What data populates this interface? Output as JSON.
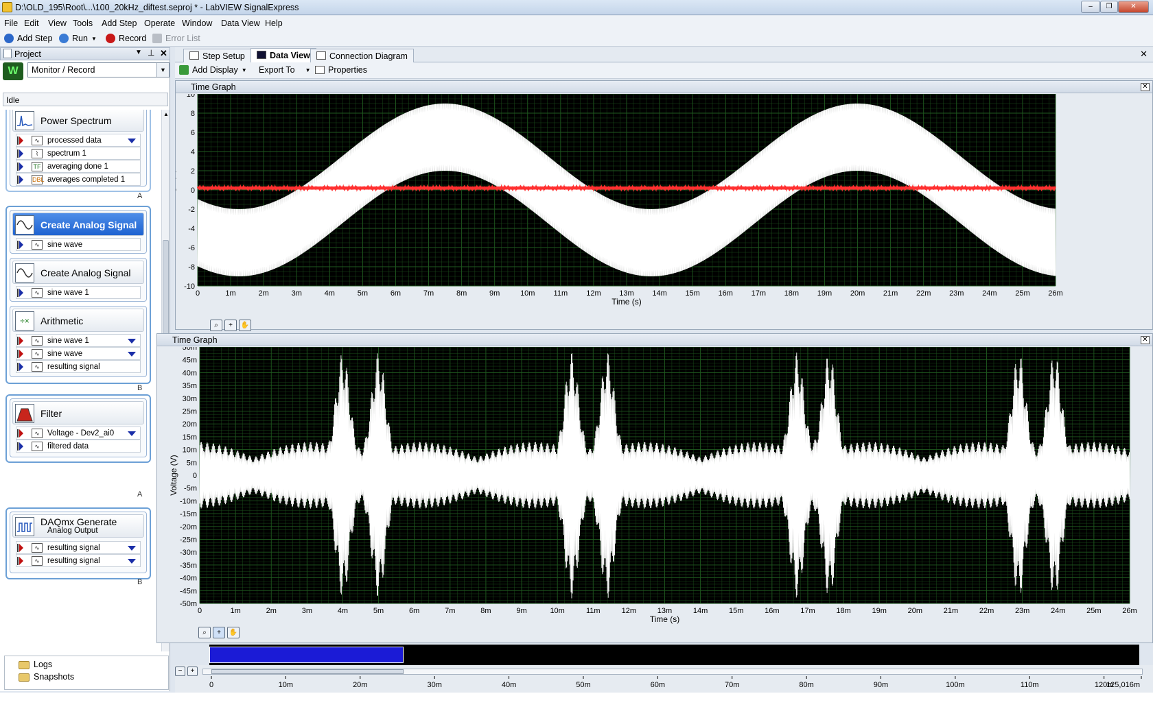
{
  "window": {
    "title": "D:\\OLD_195\\Root\\...\\100_20kHz_diftest.seproj * - LabVIEW SignalExpress",
    "controls": [
      "–",
      "❐",
      "✕"
    ]
  },
  "menu": [
    "File",
    "Edit",
    "View",
    "Tools",
    "Add Step",
    "Operate",
    "Window",
    "Data View",
    "Help"
  ],
  "toolbar": {
    "add_step": "Add Step",
    "run": "Run",
    "record": "Record",
    "error_list": "Error List"
  },
  "project": {
    "header": "Project",
    "mode": "Monitor / Record",
    "status": "Idle",
    "steps": [
      {
        "name": "Power Spectrum",
        "rows": [
          {
            "dir": "in",
            "label": "processed data",
            "dropdown": true
          },
          {
            "dir": "out",
            "label": "spectrum 1"
          },
          {
            "dir": "out",
            "label": "averaging done 1"
          },
          {
            "dir": "out",
            "label": "averages completed 1"
          }
        ],
        "group": "A"
      },
      {
        "name": "Create Analog Signal",
        "selected": true,
        "rows": [
          {
            "dir": "out",
            "label": "sine wave"
          }
        ]
      },
      {
        "name": "Create Analog Signal",
        "rows": [
          {
            "dir": "out",
            "label": "sine wave 1"
          }
        ]
      },
      {
        "name": "Arithmetic",
        "rows": [
          {
            "dir": "in",
            "label": "sine wave 1",
            "dropdown": true
          },
          {
            "dir": "in",
            "label": "sine wave",
            "dropdown": true
          },
          {
            "dir": "out",
            "label": "resulting signal"
          }
        ],
        "group": "B"
      },
      {
        "name": "Filter",
        "rows": [
          {
            "dir": "in",
            "label": "Voltage - Dev2_ai0",
            "dropdown": true
          },
          {
            "dir": "out",
            "label": "filtered data"
          }
        ],
        "group": "A"
      },
      {
        "name": "DAQmx Generate",
        "subtitle": "Analog Output",
        "rows": [
          {
            "dir": "in",
            "label": "resulting signal",
            "dropdown": true
          },
          {
            "dir": "in",
            "label": "resulting signal",
            "dropdown": true
          }
        ],
        "group": "B"
      }
    ],
    "tree": [
      "Logs",
      "Snapshots"
    ]
  },
  "tabs": [
    {
      "label": "Step Setup"
    },
    {
      "label": "Data View",
      "active": true
    },
    {
      "label": "Connection Diagram"
    }
  ],
  "data_view_toolbar": {
    "add_display": "Add Display",
    "export_to": "Export To",
    "properties": "Properties"
  },
  "colors": {
    "plot_bg": "#000000",
    "grid": "#1f5a1f",
    "trace": "#ffffff",
    "trace2": "#ff3030",
    "overview_sel": "#1b1bd6"
  },
  "chart_data": [
    {
      "type": "line",
      "panel_title": "Time Graph",
      "xlabel": "Time (s)",
      "ylabel": "Voltage (V)",
      "xlim": [
        0,
        0.026
      ],
      "ylim": [
        -10,
        10
      ],
      "xticks": [
        "0",
        "1m",
        "2m",
        "3m",
        "4m",
        "5m",
        "6m",
        "7m",
        "8m",
        "9m",
        "10m",
        "11m",
        "12m",
        "13m",
        "14m",
        "15m",
        "16m",
        "17m",
        "18m",
        "19m",
        "20m",
        "21m",
        "22m",
        "23m",
        "24m",
        "25m",
        "26m"
      ],
      "yticks": [
        "10",
        "8",
        "6",
        "4",
        "2",
        "0",
        "-2",
        "-4",
        "-6",
        "-8",
        "-10"
      ],
      "series": [
        {
          "color": "#ffffff",
          "kind": "carrier",
          "offset_amplitude": 5.5,
          "offset_period": 0.0125,
          "offset_peak_at": 0.0075,
          "band_halfwidth": 3.5,
          "carrier_hz": 20000
        },
        {
          "color": "#ff3030",
          "kind": "flat",
          "level": 0.2
        }
      ]
    },
    {
      "type": "line",
      "panel_title": "Time Graph",
      "xlabel": "Time (s)",
      "ylabel": "Voltage (V)",
      "xlim": [
        0,
        0.026
      ],
      "ylim": [
        -0.05,
        0.05
      ],
      "xticks": [
        "0",
        "1m",
        "2m",
        "3m",
        "4m",
        "5m",
        "6m",
        "7m",
        "8m",
        "9m",
        "10m",
        "11m",
        "12m",
        "13m",
        "14m",
        "15m",
        "16m",
        "17m",
        "18m",
        "19m",
        "20m",
        "21m",
        "22m",
        "23m",
        "24m",
        "25m",
        "26m"
      ],
      "yticks": [
        "50m",
        "45m",
        "40m",
        "35m",
        "30m",
        "25m",
        "20m",
        "15m",
        "10m",
        "5m",
        "0",
        "-5m",
        "-10m",
        "-15m",
        "-20m",
        "-25m",
        "-30m",
        "-35m",
        "-40m",
        "-45m",
        "-50m"
      ],
      "series": [
        {
          "color": "#ffffff",
          "kind": "burst",
          "burst_centers": [
            0.004,
            0.005,
            0.0104,
            0.0114,
            0.0167,
            0.0176,
            0.0229,
            0.0239
          ],
          "peak": 0.048,
          "base": 0.007
        }
      ]
    },
    {
      "type": "area",
      "panel_title": "overview",
      "xlim": [
        0,
        0.125016
      ],
      "xticks": [
        "0",
        "10m",
        "20m",
        "30m",
        "40m",
        "50m",
        "60m",
        "70m",
        "80m",
        "90m",
        "100m",
        "110m",
        "120m",
        "125,016m"
      ],
      "selection": [
        0,
        0.026
      ]
    }
  ]
}
